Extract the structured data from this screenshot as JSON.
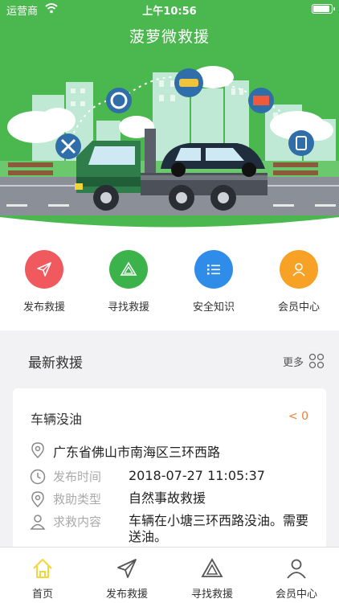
{
  "status_bar": {
    "carrier": "运营商",
    "time": "上午10:56"
  },
  "nav": {
    "title": "菠萝微救援"
  },
  "quick_actions": [
    {
      "label": "发布救援",
      "color": "#f05a5f"
    },
    {
      "label": "寻找救援",
      "color": "#3cb34a"
    },
    {
      "label": "安全知识",
      "color": "#2f8ce8"
    },
    {
      "label": "会员中心",
      "color": "#f7a227"
    }
  ],
  "section": {
    "title": "最新救援",
    "more_label": "更多"
  },
  "rescue_card": {
    "title": "车辆没油",
    "distance": "< 0",
    "address": "广东省佛山市南海区三环西路",
    "publish_time_label": "发布时间",
    "publish_time": "2018-07-27 11:05:37",
    "type_label": "救助类型",
    "type": "自然事故救援",
    "content_label": "求救内容",
    "content": "车辆在小塘三环西路没油。需要送油。"
  },
  "tabbar": [
    {
      "label": "首页",
      "active": true
    },
    {
      "label": "发布救援"
    },
    {
      "label": "寻找救援"
    },
    {
      "label": "会员中心"
    }
  ],
  "colors": {
    "brand_green": "#4bb84f",
    "active_tab": "#f3d53c",
    "accent_orange": "#f07f3c"
  }
}
